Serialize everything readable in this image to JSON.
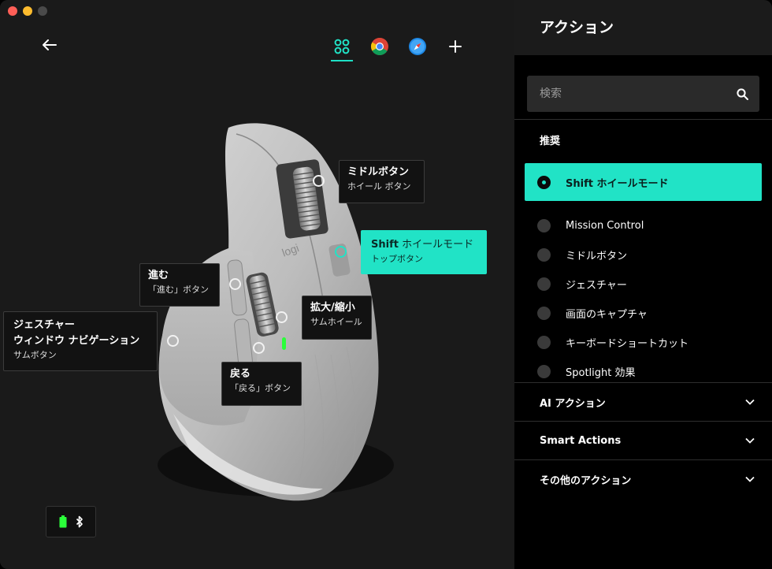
{
  "window": {
    "title": "アクション"
  },
  "app_tabs": [
    {
      "name": "all-apps",
      "icon": "grid-dots-icon",
      "active": true
    },
    {
      "name": "chrome",
      "icon": "chrome-icon",
      "active": false
    },
    {
      "name": "safari",
      "icon": "safari-icon",
      "active": false
    },
    {
      "name": "add",
      "icon": "plus-icon",
      "active": false
    }
  ],
  "mouse": {
    "brand_text": "logi",
    "callouts": {
      "middle": {
        "title": "ミドルボタン",
        "sub": "ホイール ボタン"
      },
      "shift": {
        "title_bold": "Shift",
        "title_rest": " ホイールモード",
        "sub": "トップボタン"
      },
      "forward": {
        "title": "進む",
        "sub": "「進む」ボタン"
      },
      "zoom": {
        "title": "拡大/縮小",
        "sub": "サムホイール"
      },
      "gesture": {
        "title1": "ジェスチャー",
        "title2": "ウィンドウ ナビゲーション",
        "sub": "サムボタン"
      },
      "back": {
        "title": "戻る",
        "sub": "「戻る」ボタン"
      }
    }
  },
  "status": {
    "battery_icon": "battery-icon",
    "connection_icon": "bluetooth-icon"
  },
  "panel": {
    "header": "アクション",
    "search_placeholder": "検索",
    "recommended_title": "推奨",
    "actions": [
      {
        "label": "Shift ホイールモード",
        "selected": true
      },
      {
        "label": "Mission Control",
        "selected": false
      },
      {
        "label": "ミドルボタン",
        "selected": false
      },
      {
        "label": "ジェスチャー",
        "selected": false
      },
      {
        "label": "画面のキャプチャ",
        "selected": false
      },
      {
        "label": "キーボードショートカット",
        "selected": false
      },
      {
        "label": "Spotlight 効果",
        "selected": false
      }
    ],
    "sections": [
      {
        "label": "AI アクション"
      },
      {
        "label": "Smart Actions"
      },
      {
        "label": "その他のアクション"
      }
    ]
  },
  "colors": {
    "accent": "#21e3c6",
    "panel_bg": "#000000",
    "canvas_bg": "#1a1a1a"
  }
}
